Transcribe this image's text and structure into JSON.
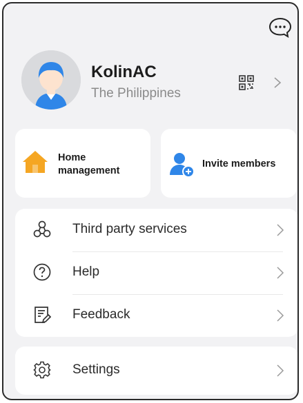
{
  "profile": {
    "name": "KolinAC",
    "country": "The Philippines"
  },
  "cards": {
    "home_label": "Home management",
    "invite_label": "Invite members"
  },
  "menu": [
    {
      "label": "Third party services",
      "icon": "third-party-services-icon"
    },
    {
      "label": "Help",
      "icon": "help-icon"
    },
    {
      "label": "Feedback",
      "icon": "feedback-icon"
    }
  ],
  "settings": {
    "label": "Settings",
    "icon": "gear-icon"
  },
  "colors": {
    "accent": "#2f86e8",
    "home": "#f5a623",
    "background": "#f2f2f4"
  }
}
